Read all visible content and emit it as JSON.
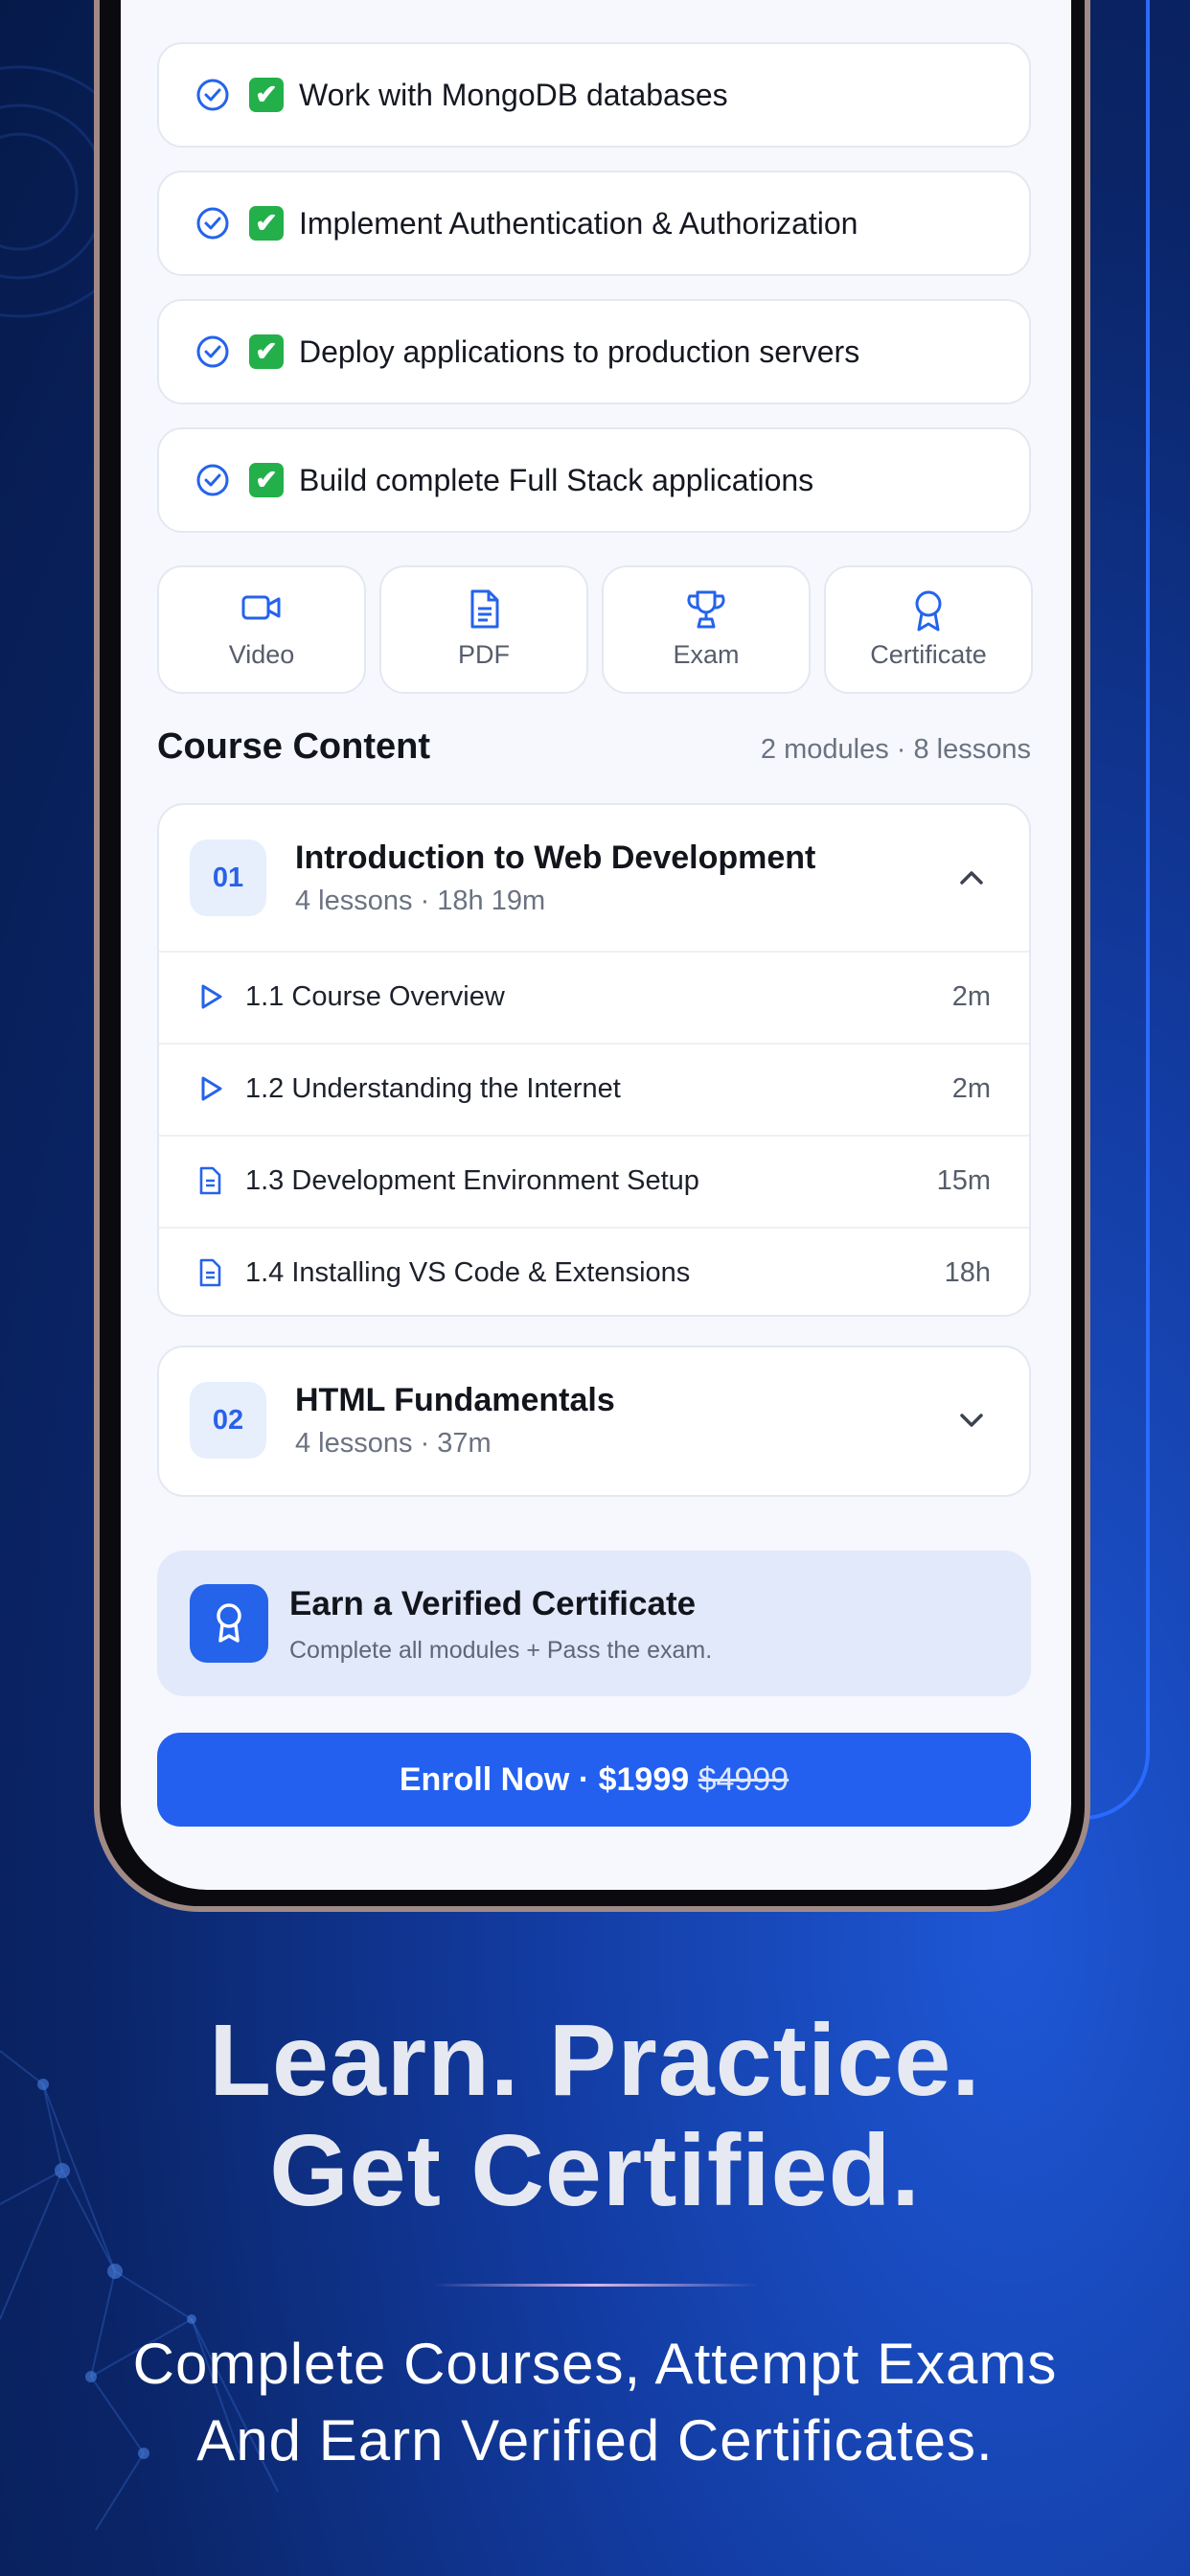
{
  "outcomes": [
    {
      "check": "✔",
      "text": "Work with MongoDB databases"
    },
    {
      "check": "✔",
      "text": "Implement Authentication & Authorization"
    },
    {
      "check": "✔",
      "text": "Deploy applications to production servers"
    },
    {
      "check": "✔",
      "text": "Build complete Full Stack applications"
    }
  ],
  "features": [
    {
      "label": "Video",
      "icon": "video-icon"
    },
    {
      "label": "PDF",
      "icon": "document-icon"
    },
    {
      "label": "Exam",
      "icon": "trophy-icon"
    },
    {
      "label": "Certificate",
      "icon": "award-icon"
    }
  ],
  "course_content": {
    "title": "Course Content",
    "meta": "2 modules · 8 lessons"
  },
  "modules": [
    {
      "number": "01",
      "title": "Introduction to Web Development",
      "subtitle": "4 lessons · 18h 19m",
      "expanded": true,
      "lessons": [
        {
          "title": "1.1 Course Overview",
          "duration": "2m",
          "icon": "play-icon"
        },
        {
          "title": "1.2 Understanding the Internet",
          "duration": "2m",
          "icon": "play-icon"
        },
        {
          "title": "1.3 Development Environment Setup",
          "duration": "15m",
          "icon": "document-icon"
        },
        {
          "title": "1.4 Installing VS Code & Extensions",
          "duration": "18h",
          "icon": "document-icon"
        }
      ]
    },
    {
      "number": "02",
      "title": "HTML Fundamentals",
      "subtitle": "4 lessons · 37m",
      "expanded": false
    }
  ],
  "certificate": {
    "title": "Earn a Verified Certificate",
    "subtitle": "Complete all modules + Pass the exam."
  },
  "enroll": {
    "label": "Enroll Now · $1999",
    "old_price": "$4999"
  },
  "marketing": {
    "headline_line1": "Learn. Practice.",
    "headline_line2": "Get Certified.",
    "sub_line1": "Complete Courses, Attempt Exams",
    "sub_line2": "And Earn Verified Certificates."
  },
  "colors": {
    "accent": "#2360f0",
    "check_green": "#23b04a",
    "background_dark": "#0a2466"
  }
}
